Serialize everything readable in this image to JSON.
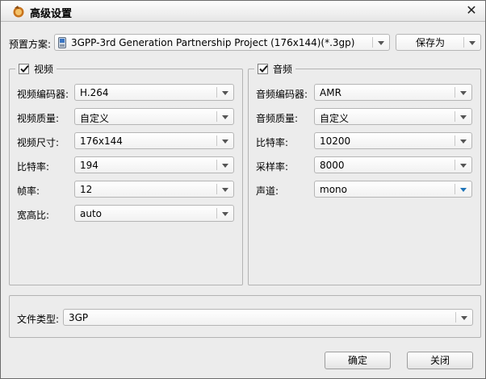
{
  "window": {
    "title": "高级设置"
  },
  "preset": {
    "label": "预置方案:",
    "value": "3GPP-3rd Generation Partnership Project (176x144)(*.3gp)",
    "save_as": "保存为"
  },
  "video": {
    "title": "视频",
    "fields": [
      {
        "label": "视频编码器:",
        "value": "H.264"
      },
      {
        "label": "视频质量:",
        "value": "自定义"
      },
      {
        "label": "视频尺寸:",
        "value": "176x144"
      },
      {
        "label": "比特率:",
        "value": "194"
      },
      {
        "label": "帧率:",
        "value": "12"
      },
      {
        "label": "宽高比:",
        "value": "auto"
      }
    ]
  },
  "audio": {
    "title": "音频",
    "fields": [
      {
        "label": "音频编码器:",
        "value": "AMR"
      },
      {
        "label": "音频质量:",
        "value": "自定义"
      },
      {
        "label": "比特率:",
        "value": "10200"
      },
      {
        "label": "采样率:",
        "value": "8000"
      },
      {
        "label": "声道:",
        "value": "mono"
      }
    ]
  },
  "filetype": {
    "label": "文件类型:",
    "value": "3GP"
  },
  "buttons": {
    "ok": "确定",
    "close": "关闭"
  },
  "icons": {
    "app": "app-logo-icon",
    "close": "close-icon",
    "preset": "phone-icon"
  }
}
